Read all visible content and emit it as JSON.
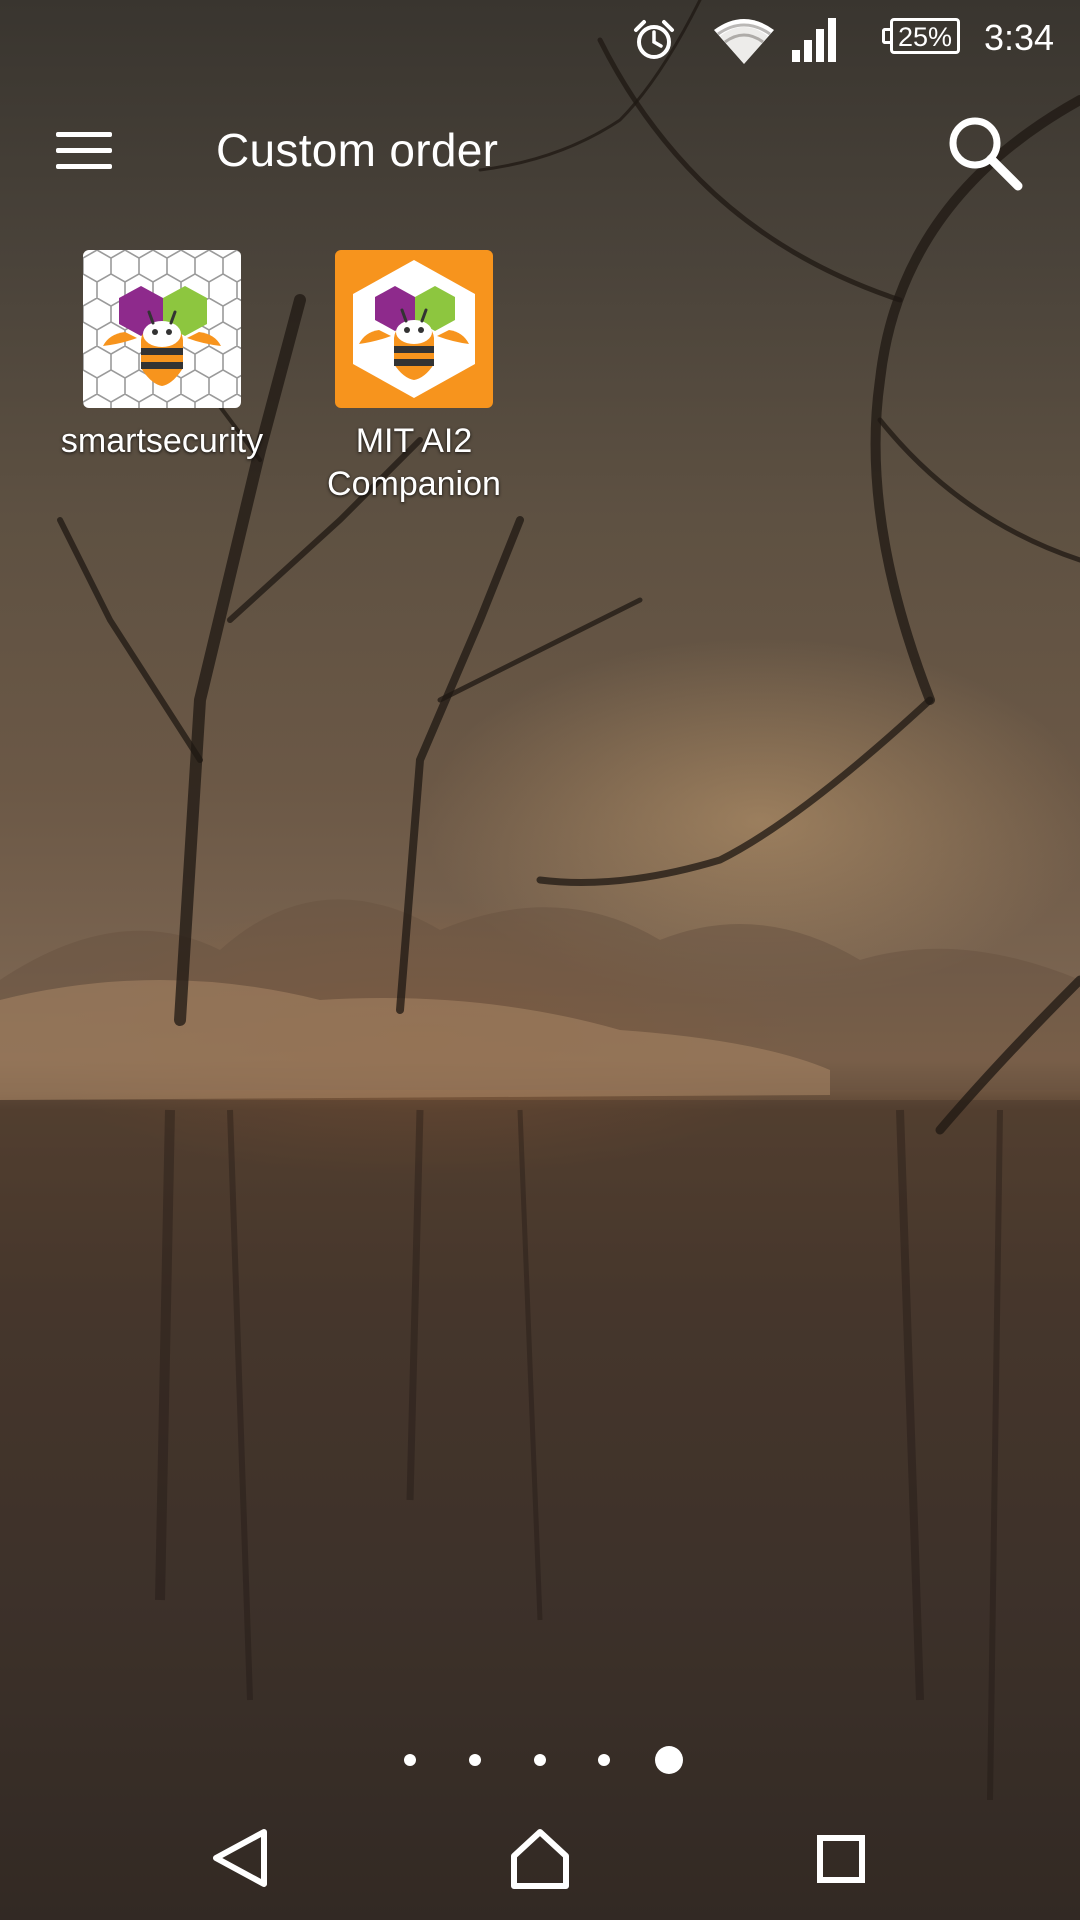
{
  "status_bar": {
    "icons": [
      "alarm-icon",
      "wifi-icon",
      "cell-signal-icon",
      "battery-icon"
    ],
    "battery": "25%",
    "battery_level": 0.25,
    "time": "3:34"
  },
  "app_bar": {
    "menu_icon": "hamburger-menu-icon",
    "title": "Custom order",
    "search_icon": "search-icon"
  },
  "apps": [
    {
      "label": "smartsecurity",
      "icon": "app-inventor-bee-hexagon-icon",
      "background": "#ffffff",
      "tile_color": "#e6e6e6"
    },
    {
      "label": "MIT AI2\nCompanion",
      "icon": "app-inventor-bee-hexagon-icon",
      "background": "#f7941d",
      "tile_color": "#ffffff"
    }
  ],
  "icon_colors": {
    "purple": "#8e2a8c",
    "green": "#8dc63f",
    "orange": "#f7941d",
    "stripe": "#333333"
  },
  "home_pages": {
    "count": 5,
    "current": 5
  },
  "nav_bar": {
    "back": "back-triangle-icon",
    "home": "home-icon",
    "recents": "recents-square-icon"
  }
}
